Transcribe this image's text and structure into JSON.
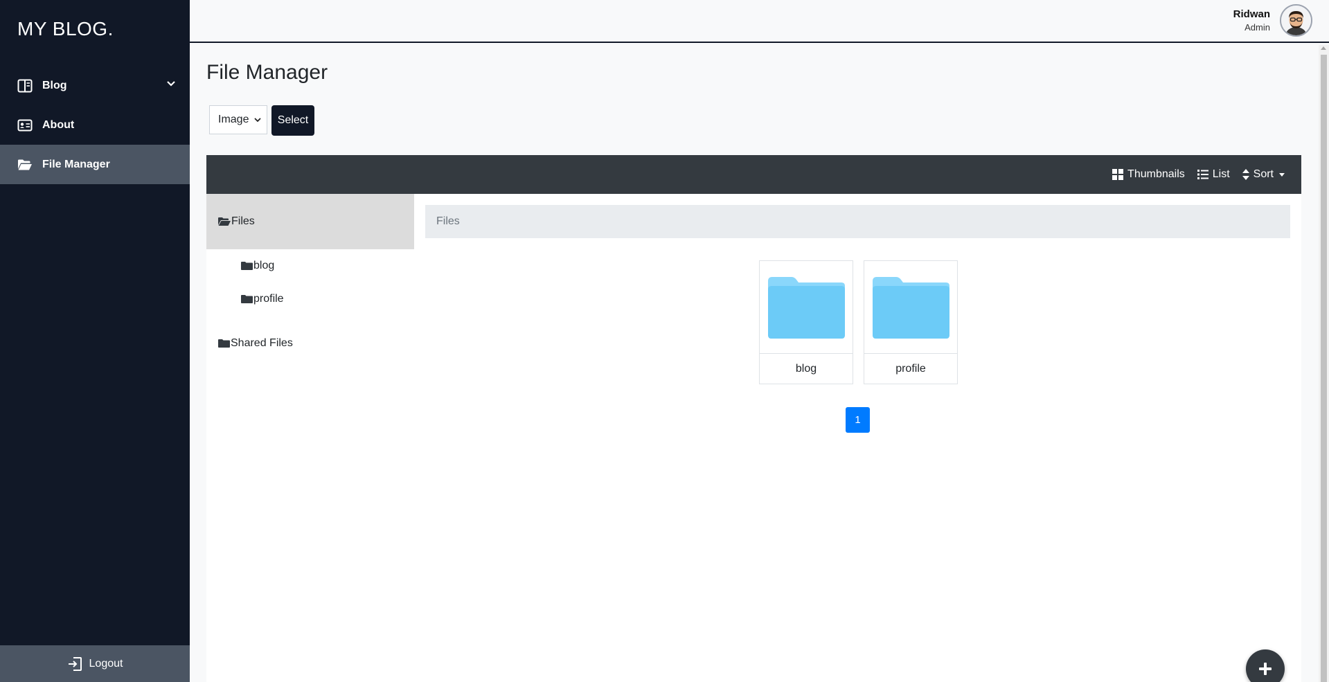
{
  "sidebar": {
    "brand": "MY BLOG.",
    "items": [
      {
        "label": "Blog",
        "icon": "book-open-icon",
        "has_dropdown": true
      },
      {
        "label": "About",
        "icon": "id-card-icon"
      },
      {
        "label": "File Manager",
        "icon": "folder-open-icon",
        "active": true
      }
    ],
    "logout_label": "Logout"
  },
  "topbar": {
    "user_name": "Ridwan",
    "user_role": "Admin"
  },
  "main": {
    "title": "File Manager",
    "type_select": {
      "selected": "Image"
    },
    "select_button": "Select"
  },
  "file_manager": {
    "toolbar": {
      "thumbnails": "Thumbnails",
      "list": "List",
      "sort": "Sort"
    },
    "tree": {
      "root": "Files",
      "children": [
        "blog",
        "profile"
      ],
      "shared": "Shared Files"
    },
    "breadcrumb": "Files",
    "folders": [
      {
        "name": "blog"
      },
      {
        "name": "profile"
      }
    ],
    "pagination": {
      "current": "1"
    }
  },
  "colors": {
    "sidebar_bg": "#111827",
    "active_item": "#4b5563",
    "toolbar_bg": "#343a40",
    "folder": "#6ccbf7",
    "page_accent": "#007bff"
  }
}
